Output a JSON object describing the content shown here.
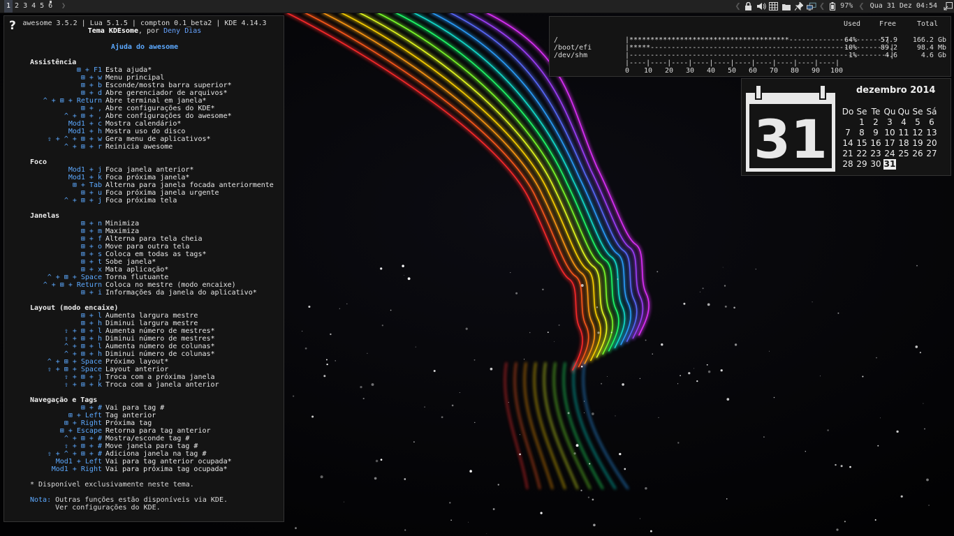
{
  "topbar": {
    "tags": [
      "1",
      "2",
      "3",
      "4",
      "5",
      "6"
    ],
    "focused_tag": "1",
    "battery": "97%",
    "clock": "Qua 31 Dez 04:54",
    "tray_icons": [
      "lock-icon",
      "volume-icon",
      "keyboard-icon",
      "folder-icon",
      "pin-icon",
      "network-icon",
      "battery-icon",
      "layout-icon"
    ]
  },
  "help": {
    "header_line1": "awesome 3.5.2 | Lua 5.1.5 | compton 0.1_beta2 | KDE 4.14.3",
    "header_theme": "Tema KDEsome",
    "header_by": ", por ",
    "header_author": "Deny Dias",
    "title": "Ajuda do awesome",
    "sections": [
      {
        "title": "Assistência",
        "rows": [
          {
            "key": "⊞ + F1",
            "desc": "Esta ajuda*"
          },
          {
            "key": "⊞ + w",
            "desc": "Menu principal"
          },
          {
            "key": "⊞ + b",
            "desc": "Esconde/mostra barra superior*"
          },
          {
            "key": "⊞ + d",
            "desc": "Abre gerenciador de arquivos*"
          },
          {
            "key": "^ + ⊞ + Return",
            "desc": "Abre terminal em janela*"
          },
          {
            "key": "⊞ + ,",
            "desc": "Abre configurações do KDE*"
          },
          {
            "key": "^ + ⊞ + ,",
            "desc": "Abre configurações do awesome*"
          },
          {
            "key": "Mod1 + c",
            "desc": "Mostra calendário*"
          },
          {
            "key": "Mod1 + h",
            "desc": "Mostra uso do disco"
          },
          {
            "key": "⇧ + ^ + ⊞ + w",
            "desc": "Gera menu de aplicativos*"
          },
          {
            "key": "^ + ⊞ + r",
            "desc": "Reinicia awesome"
          }
        ]
      },
      {
        "title": "Foco",
        "rows": [
          {
            "key": "Mod1 + j",
            "desc": "Foca janela anterior*"
          },
          {
            "key": "Mod1 + k",
            "desc": "Foca próxima janela*"
          },
          {
            "key": "⊞ + Tab",
            "desc": "Alterna para janela focada anteriormente"
          },
          {
            "key": "⊞ + u",
            "desc": "Foca próxima janela urgente"
          },
          {
            "key": "^ + ⊞ + j",
            "desc": "Foca próxima tela"
          }
        ]
      },
      {
        "title": "Janelas",
        "rows": [
          {
            "key": "⊞ + n",
            "desc": "Minimiza"
          },
          {
            "key": "⊞ + m",
            "desc": "Maximiza"
          },
          {
            "key": "⊞ + f",
            "desc": "Alterna para tela cheia"
          },
          {
            "key": "⊞ + o",
            "desc": "Move para outra tela"
          },
          {
            "key": "⊞ + s",
            "desc": "Coloca em todas as tags*"
          },
          {
            "key": "⊞ + t",
            "desc": "Sobe janela*"
          },
          {
            "key": "⊞ + x",
            "desc": "Mata aplicação*"
          },
          {
            "key": "^ + ⊞ + Space",
            "desc": "Torna flutuante"
          },
          {
            "key": "^ + ⊞ + Return",
            "desc": "Coloca no mestre (modo encaixe)"
          },
          {
            "key": "⊞ + i",
            "desc": "Informações da janela do aplicativo*"
          }
        ]
      },
      {
        "title": "Layout (modo encaixe)",
        "rows": [
          {
            "key": "⊞ + l",
            "desc": "Aumenta largura mestre"
          },
          {
            "key": "⊞ + h",
            "desc": "Diminui largura mestre"
          },
          {
            "key": "⇧ + ⊞ + l",
            "desc": "Aumenta número de mestres*"
          },
          {
            "key": "⇧ + ⊞ + h",
            "desc": "Diminui número de mestres*"
          },
          {
            "key": "^ + ⊞ + l",
            "desc": "Aumenta número de colunas*"
          },
          {
            "key": "^ + ⊞ + h",
            "desc": "Diminui número de colunas*"
          },
          {
            "key": "^ + ⊞ + Space",
            "desc": "Próximo layout*"
          },
          {
            "key": "⇧ + ⊞ + Space",
            "desc": "Layout anterior"
          },
          {
            "key": "⇧ + ⊞ + j",
            "desc": "Troca com a próxima janela"
          },
          {
            "key": "⇧ + ⊞ + k",
            "desc": "Troca com a janela anterior"
          }
        ]
      },
      {
        "title": "Navegação e Tags",
        "rows": [
          {
            "key": "⊞ + #",
            "desc": "Vai para tag #"
          },
          {
            "key": "⊞ + Left",
            "desc": "Tag anterior"
          },
          {
            "key": "⊞ + Right",
            "desc": "Próxima tag"
          },
          {
            "key": "⊞ + Escape",
            "desc": "Retorna para tag anterior"
          },
          {
            "key": "^ + ⊞ + #",
            "desc": "Mostra/esconde tag #"
          },
          {
            "key": "⇧ + ⊞ + #",
            "desc": "Move janela para tag #"
          },
          {
            "key": "⇧ + ^ + ⊞ + #",
            "desc": "Adiciona janela na tag #"
          },
          {
            "key": "Mod1 + Left",
            "desc": "Vai para tag anterior ocupada*"
          },
          {
            "key": "Mod1 + Right",
            "desc": "Vai para próxima tag ocupada*"
          }
        ]
      }
    ],
    "footnote": "* Disponível exclusivamente neste tema.",
    "note_label": "Nota:",
    "note_line1": "Outras funções estão disponíveis via KDE.",
    "note_line2": "Ver configurações do KDE."
  },
  "disk": {
    "headers": {
      "used": "Used",
      "free": "Free",
      "total": "Total"
    },
    "rows": [
      {
        "mount": "/",
        "bar": "|**************************************-----------------------|",
        "used": "64%",
        "free": "57.9",
        "total": "166.2 Gb"
      },
      {
        "mount": "/boot/efi",
        "bar": "|*****---------------------------------------------------------|",
        "used": "10%",
        "free": "89.2",
        "total": "98.4 Mb"
      },
      {
        "mount": "/dev/shm",
        "bar": "|--------------------------------------------------------------|",
        "used": "1%",
        "free": "4.6",
        "total": "4.6 Gb"
      }
    ],
    "scale_line": "|----|----|----|----|----|----|----|----|----|----|",
    "scale_labels": [
      "0",
      "10",
      "20",
      "30",
      "40",
      "50",
      "60",
      "70",
      "80",
      "90",
      "100"
    ]
  },
  "calendar": {
    "icon_day": "31",
    "month": "dezembro 2014",
    "weekdays": [
      "Do",
      "Se",
      "Te",
      "Qu",
      "Qu",
      "Se",
      "Sá"
    ],
    "weeks": [
      [
        "",
        "1",
        "2",
        "3",
        "4",
        "5",
        "6"
      ],
      [
        "7",
        "8",
        "9",
        "10",
        "11",
        "12",
        "13"
      ],
      [
        "14",
        "15",
        "16",
        "17",
        "18",
        "19",
        "20"
      ],
      [
        "21",
        "22",
        "23",
        "24",
        "25",
        "26",
        "27"
      ],
      [
        "28",
        "29",
        "30",
        "31",
        "",
        "",
        ""
      ]
    ],
    "today": "31"
  }
}
